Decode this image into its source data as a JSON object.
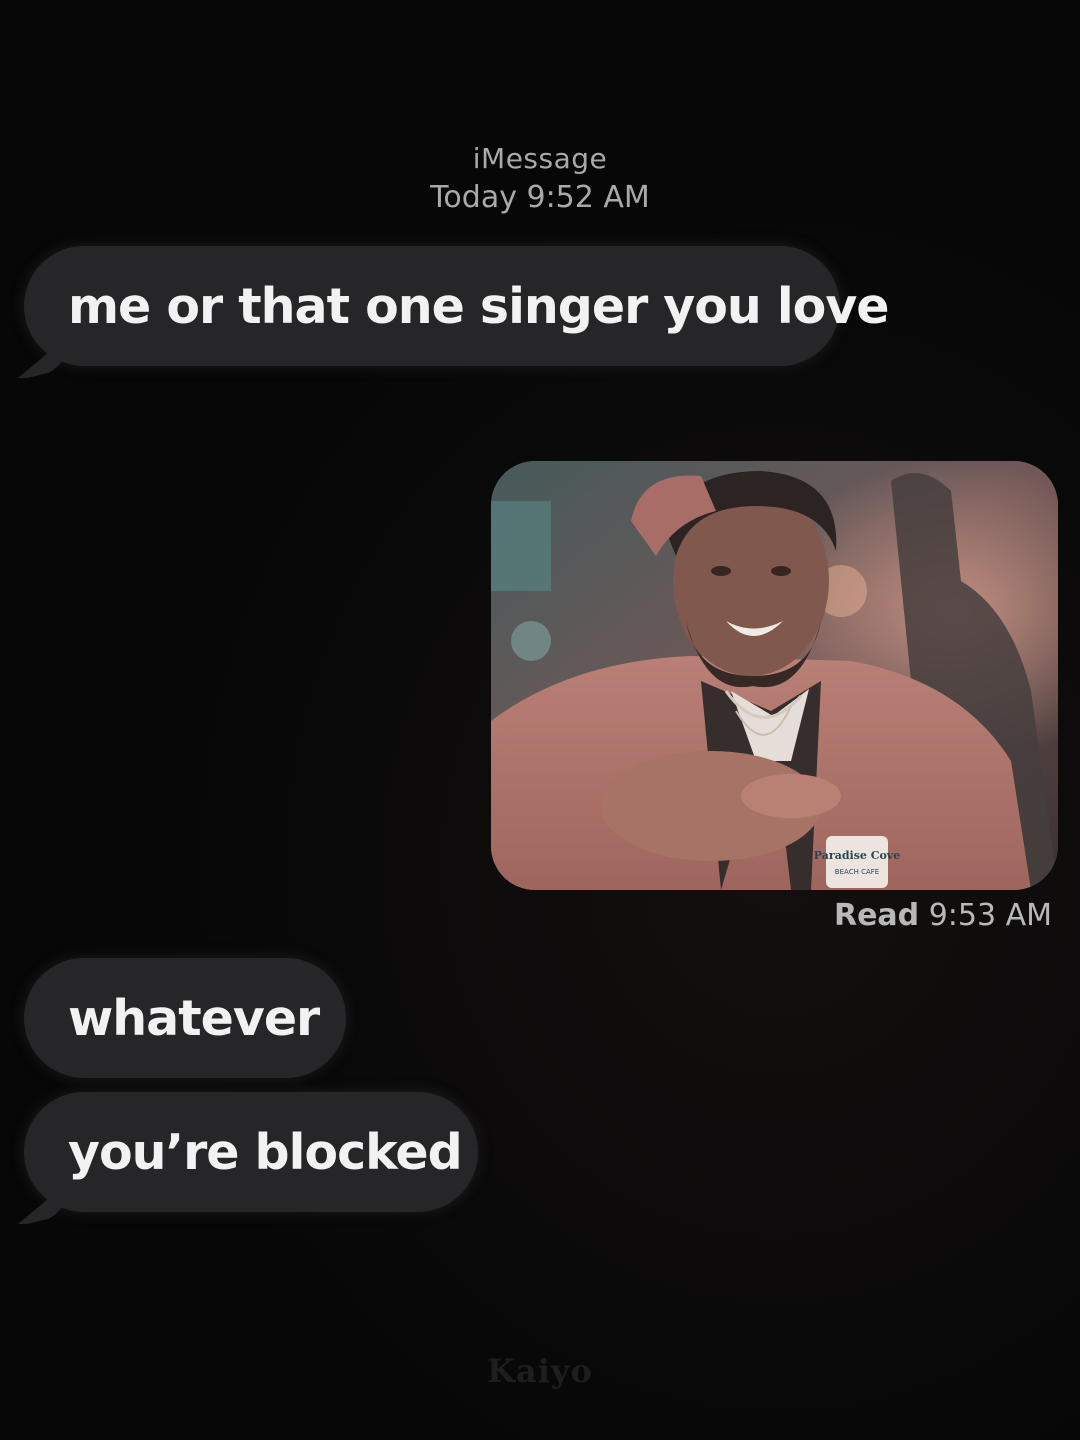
{
  "header": {
    "service": "iMessage",
    "timestamp": "Today 9:52 AM"
  },
  "messages": [
    {
      "text": "me or that one singer you love"
    },
    {
      "text": "whatever"
    },
    {
      "text": "you’re blocked"
    }
  ],
  "attachment": {
    "sign_text": "Paradise Cove",
    "sign_subtext": "BEACH CAFE"
  },
  "receipt": {
    "label": "Read",
    "time": "9:53 AM"
  },
  "watermark": "Kaiyo",
  "colors": {
    "background": "#070707",
    "bubble": "#262628",
    "bubble_text": "#f2f2f2",
    "meta_text": "#a9a9a9"
  }
}
